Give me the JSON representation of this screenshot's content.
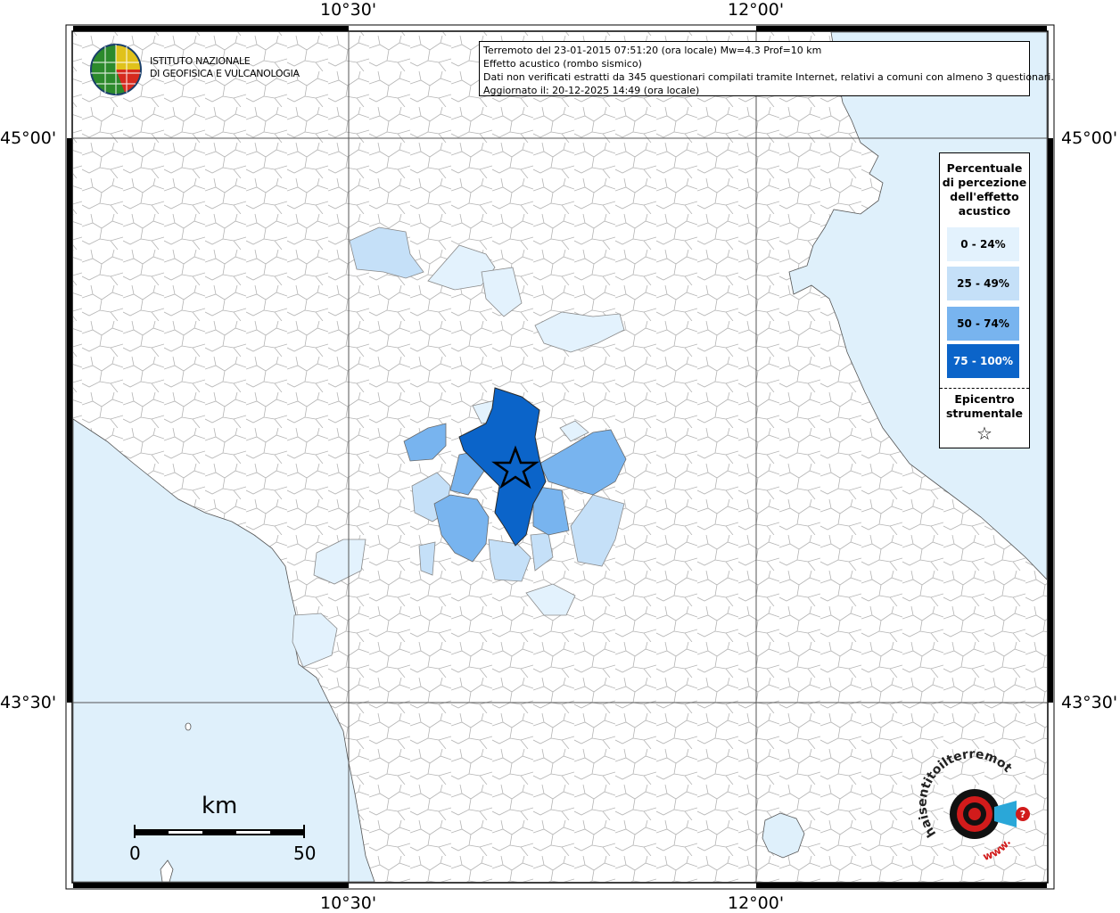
{
  "coords": {
    "lon_left": "10°30'",
    "lon_right": "12°00'",
    "lat_top": "45°00'",
    "lat_bottom": "43°30'"
  },
  "logo": {
    "line1": "ISTITUTO NAZIONALE",
    "line2": "DI GEOFISICA E VULCANOLOGIA"
  },
  "info": {
    "line1": "Terremoto del 23-01-2015 07:51:20 (ora locale) Mw=4.3 Prof=10 km",
    "line2": "Effetto acustico (rombo sismico)",
    "line3": "Dati non verificati estratti da 345 questionari compilati tramite Internet, relativi a comuni con almeno 3 questionari.",
    "line4": "Aggiornato il: 20-12-2025 14:49 (ora locale)"
  },
  "legend": {
    "title_l1": "Percentuale",
    "title_l2": "di percezione",
    "title_l3": "dell'effetto",
    "title_l4": "acustico",
    "classes": [
      {
        "label": "0 - 24%",
        "color": "#e3f2fd"
      },
      {
        "label": "25 - 49%",
        "color": "#c5e0f8"
      },
      {
        "label": "50 - 74%",
        "color": "#78b4ef"
      },
      {
        "label": "75 - 100%",
        "color": "#0b64c9"
      }
    ],
    "epi_l1": "Epicentro",
    "epi_l2": "strumentale",
    "star": "☆"
  },
  "scale": {
    "unit": "km",
    "min": "0",
    "max": "50"
  },
  "badge": {
    "text": "haisentitoilterremoto.it",
    "www": "www."
  },
  "colors": {
    "sea": "#dff0fb",
    "land": "#ffffff",
    "border": "#9a9a9a"
  }
}
